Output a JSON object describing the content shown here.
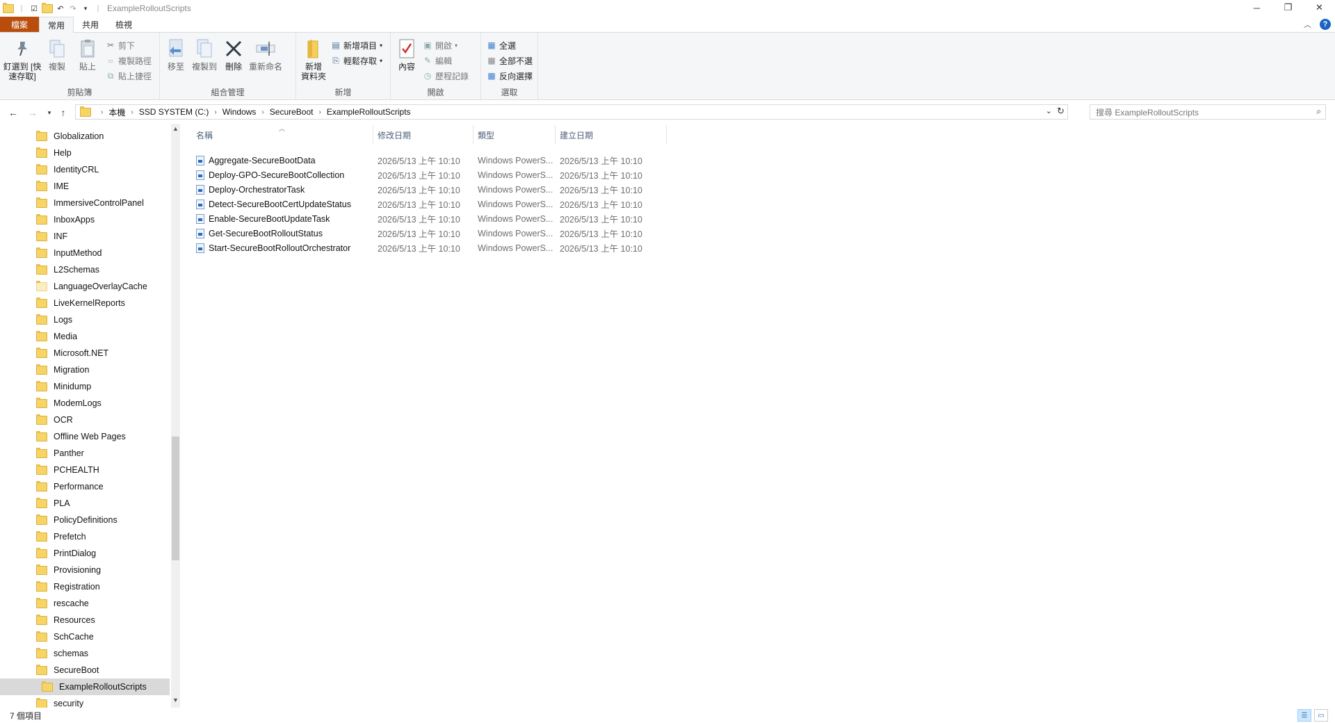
{
  "window": {
    "title": "ExampleRolloutScripts"
  },
  "tabs": [
    {
      "label": "檔案"
    },
    {
      "label": "常用"
    },
    {
      "label": "共用"
    },
    {
      "label": "檢視"
    }
  ],
  "ribbon": {
    "clipboard": {
      "pin": "釘選到 [快速存取]",
      "copy": "複製",
      "paste": "貼上",
      "cut": "剪下",
      "copy_path": "複製路徑",
      "paste_shortcut": "貼上捷徑",
      "label": "剪貼簿"
    },
    "organize": {
      "move_to": "移至",
      "copy_to": "複製到",
      "delete": "刪除",
      "rename": "重新命名",
      "label": "組合管理"
    },
    "new": {
      "new_folder": "新增\n資料夾",
      "new_item": "新增項目",
      "easy_access": "輕鬆存取",
      "label": "新增"
    },
    "open": {
      "properties": "內容",
      "open": "開啟",
      "edit": "編輯",
      "history": "歷程記錄",
      "label": "開啟"
    },
    "select": {
      "select_all": "全選",
      "select_none": "全部不選",
      "invert": "反向選擇",
      "label": "選取"
    }
  },
  "address": {
    "crumbs": [
      "本機",
      "SSD SYSTEM (C:)",
      "Windows",
      "SecureBoot",
      "ExampleRolloutScripts"
    ]
  },
  "search": {
    "placeholder": "搜尋 ExampleRolloutScripts"
  },
  "nav_items": [
    "Globalization",
    "Help",
    "IdentityCRL",
    "IME",
    "ImmersiveControlPanel",
    "InboxApps",
    "INF",
    "InputMethod",
    "L2Schemas",
    "LanguageOverlayCache",
    "LiveKernelReports",
    "Logs",
    "Media",
    "Microsoft.NET",
    "Migration",
    "Minidump",
    "ModemLogs",
    "OCR",
    "Offline Web Pages",
    "Panther",
    "PCHEALTH",
    "Performance",
    "PLA",
    "PolicyDefinitions",
    "Prefetch",
    "PrintDialog",
    "Provisioning",
    "Registration",
    "rescache",
    "Resources",
    "SchCache",
    "schemas",
    "SecureBoot",
    "ExampleRolloutScripts",
    "security"
  ],
  "columns": {
    "name": "名稱",
    "modified": "修改日期",
    "type": "類型",
    "created": "建立日期"
  },
  "files": [
    {
      "name": "Aggregate-SecureBootData",
      "modified": "2026/5/13 上午 10:10",
      "type": "Windows PowerS...",
      "created": "2026/5/13 上午 10:10"
    },
    {
      "name": "Deploy-GPO-SecureBootCollection",
      "modified": "2026/5/13 上午 10:10",
      "type": "Windows PowerS...",
      "created": "2026/5/13 上午 10:10"
    },
    {
      "name": "Deploy-OrchestratorTask",
      "modified": "2026/5/13 上午 10:10",
      "type": "Windows PowerS...",
      "created": "2026/5/13 上午 10:10"
    },
    {
      "name": "Detect-SecureBootCertUpdateStatus",
      "modified": "2026/5/13 上午 10:10",
      "type": "Windows PowerS...",
      "created": "2026/5/13 上午 10:10"
    },
    {
      "name": "Enable-SecureBootUpdateTask",
      "modified": "2026/5/13 上午 10:10",
      "type": "Windows PowerS...",
      "created": "2026/5/13 上午 10:10"
    },
    {
      "name": "Get-SecureBootRolloutStatus",
      "modified": "2026/5/13 上午 10:10",
      "type": "Windows PowerS...",
      "created": "2026/5/13 上午 10:10"
    },
    {
      "name": "Start-SecureBootRolloutOrchestrator",
      "modified": "2026/5/13 上午 10:10",
      "type": "Windows PowerS...",
      "created": "2026/5/13 上午 10:10"
    }
  ],
  "status": {
    "count": "7 個項目"
  }
}
